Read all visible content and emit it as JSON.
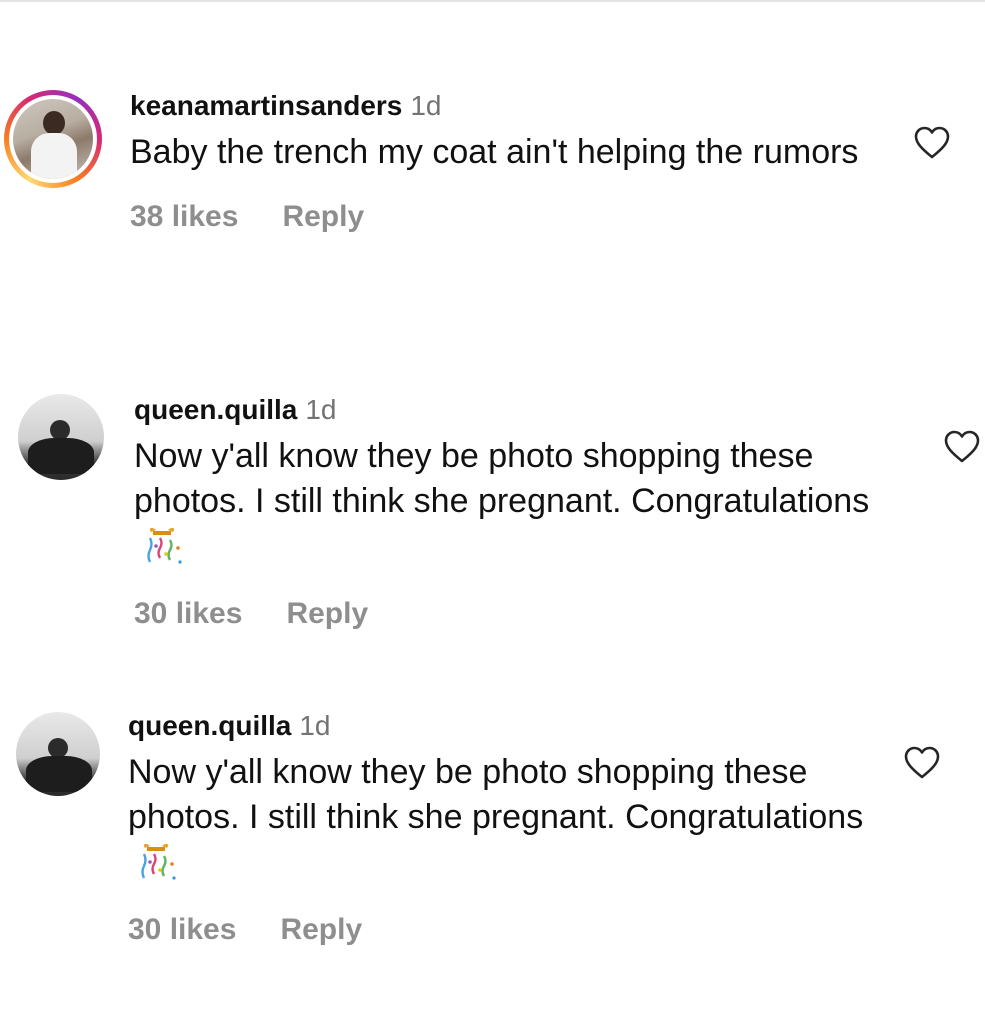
{
  "comments": [
    {
      "username": "keanamartinsanders",
      "time": "1d",
      "text": "Baby the trench my coat ain't helping the rumors",
      "emoji": "",
      "likes": "38 likes",
      "reply_label": "Reply",
      "avatar_icon": "profile-photo-icon",
      "story_ring": true
    },
    {
      "username": "queen.quilla",
      "time": "1d",
      "text": "Now y'all know they be photo shopping these photos. I still think she pregnant. Congratulations",
      "emoji": "confetti-emoji",
      "likes": "30 likes",
      "reply_label": "Reply",
      "avatar_icon": "profile-photo-icon",
      "story_ring": false
    },
    {
      "username": "queen.quilla",
      "time": "1d",
      "text": "Now y'all know they be photo shopping these photos. I still think she pregnant. Congratulations",
      "emoji": "confetti-emoji",
      "likes": "30 likes",
      "reply_label": "Reply",
      "avatar_icon": "profile-photo-icon",
      "story_ring": false
    }
  ],
  "icons": {
    "like": "heart-outline-icon"
  },
  "colors": {
    "text": "#111111",
    "muted": "#737373",
    "action": "#8e8e8e",
    "story_ring": [
      "#feda75",
      "#fa7e1e",
      "#d62976",
      "#962fbf"
    ]
  }
}
